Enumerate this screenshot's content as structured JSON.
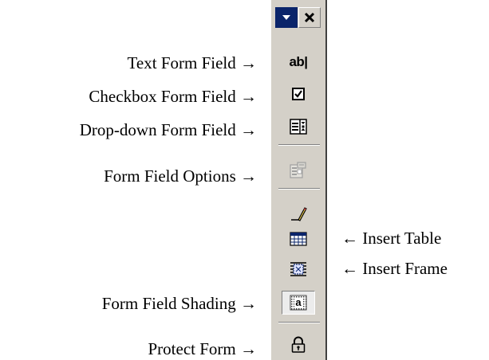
{
  "toolbar": {
    "title_buttons": [
      "menu-arrow",
      "close"
    ],
    "tools": [
      {
        "name": "text-form-field",
        "icon": "ab-text-icon",
        "glyph": "ab|",
        "label": "Text Form Field →"
      },
      {
        "name": "checkbox-form-field",
        "icon": "checkbox-icon",
        "label": "Checkbox Form Field →"
      },
      {
        "name": "drop-down-form-field",
        "icon": "dropdown-list-icon",
        "label": "Drop-down Form Field →"
      },
      {
        "name": "form-field-options",
        "icon": "properties-icon",
        "label": "Form Field Options →",
        "disabled": true
      },
      {
        "name": "draw-table",
        "icon": "pencil-icon"
      },
      {
        "name": "insert-table",
        "icon": "table-grid-icon",
        "label": "← Insert Table"
      },
      {
        "name": "insert-frame",
        "icon": "frame-icon",
        "label": "← Insert Frame"
      },
      {
        "name": "form-field-shading",
        "icon": "shaded-a-icon",
        "glyph": "a",
        "label": "Form Field Shading →",
        "pressed": true
      },
      {
        "name": "protect-form",
        "icon": "padlock-icon",
        "label": "Protect Form →"
      }
    ]
  },
  "colors": {
    "toolbar_bg": "#d4d0c8",
    "titlebar_active": "#0a246a",
    "shadow": "#808080",
    "highlight": "#ffffff",
    "disabled_gray": "#a0a0a0"
  }
}
